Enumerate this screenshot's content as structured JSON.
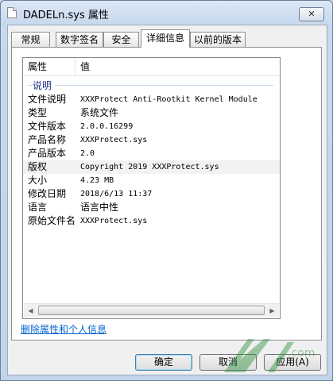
{
  "window": {
    "title": "DADELn.sys 属性",
    "close_label": "✕"
  },
  "tabs": [
    {
      "label": "常规"
    },
    {
      "label": "数字签名"
    },
    {
      "label": "安全"
    },
    {
      "label": "详细信息",
      "active": true
    },
    {
      "label": "以前的版本"
    }
  ],
  "details": {
    "columns": {
      "property": "属性",
      "value": "值"
    },
    "group": "说明",
    "rows": [
      {
        "key": "文件说明",
        "value": "XXXProtect Anti-Rootkit Kernel Module"
      },
      {
        "key": "类型",
        "value": "系统文件"
      },
      {
        "key": "文件版本",
        "value": "2.0.0.16299"
      },
      {
        "key": "产品名称",
        "value": "XXXProtect.sys"
      },
      {
        "key": "产品版本",
        "value": "2.0"
      },
      {
        "key": "版权",
        "value": "Copyright 2019 XXXProtect.sys"
      },
      {
        "key": "大小",
        "value": "4.23 MB"
      },
      {
        "key": "修改日期",
        "value": "2018/6/13 11:37"
      },
      {
        "key": "语言",
        "value": "语言中性"
      },
      {
        "key": "原始文件名",
        "value": "XXXProtect.sys"
      }
    ]
  },
  "remove_link": "删除属性和个人信息",
  "buttons": {
    "ok": "确定",
    "cancel": "取消",
    "apply": "应用(A)"
  },
  "scrollbar": {
    "left_icon": "◀",
    "right_icon": "▶"
  },
  "watermark": {
    "text": ".com"
  }
}
